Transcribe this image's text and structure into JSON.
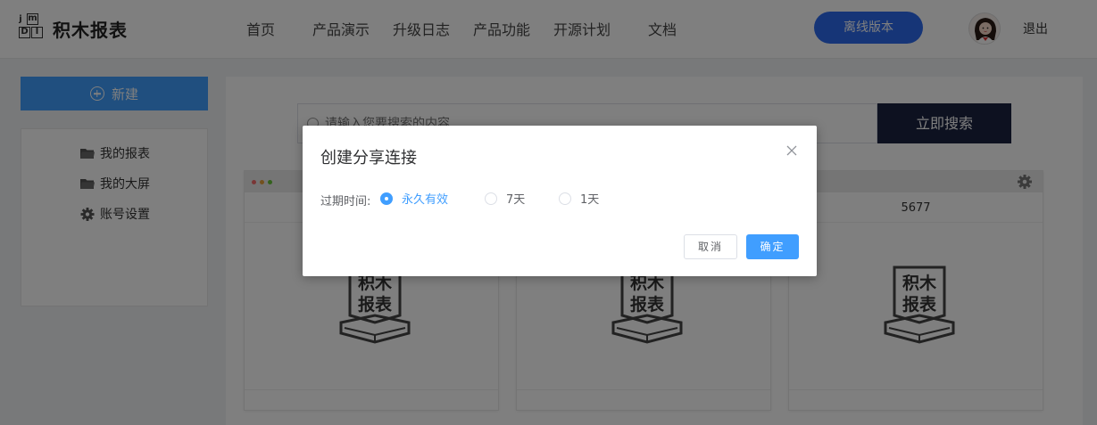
{
  "header": {
    "logo_text": "积木报表",
    "logo_blocks": [
      "m",
      "D",
      "I",
      "j"
    ],
    "nav": [
      "首页",
      "产品演示",
      "升级日志",
      "产品功能",
      "开源计划",
      "文档"
    ],
    "offline_label": "离线版本",
    "logout_label": "退出"
  },
  "sidebar": {
    "new_label": "新建",
    "items": [
      {
        "label": "我的报表",
        "icon": "folder-icon"
      },
      {
        "label": "我的大屏",
        "icon": "folder-icon"
      },
      {
        "label": "账号设置",
        "icon": "gear-icon"
      }
    ]
  },
  "search": {
    "placeholder": "请输入您要搜索的内容",
    "button_label": "立即搜索"
  },
  "cards": [
    {
      "title": "",
      "logo_text": [
        "积木",
        "报表"
      ]
    },
    {
      "title": "",
      "logo_text": [
        "积木",
        "报表"
      ]
    },
    {
      "title": "5677",
      "logo_text": [
        "积木",
        "报表"
      ]
    }
  ],
  "dialog": {
    "title": "创建分享连接",
    "expire_label": "过期时间:",
    "options": [
      {
        "label": "永久有效",
        "checked": true
      },
      {
        "label": "7天",
        "checked": false
      },
      {
        "label": "1天",
        "checked": false
      }
    ],
    "cancel_label": "取消",
    "confirm_label": "确定"
  },
  "colors": {
    "primary": "#409eff",
    "offline_button": "#2d6bef",
    "search_button": "#1b2340"
  }
}
